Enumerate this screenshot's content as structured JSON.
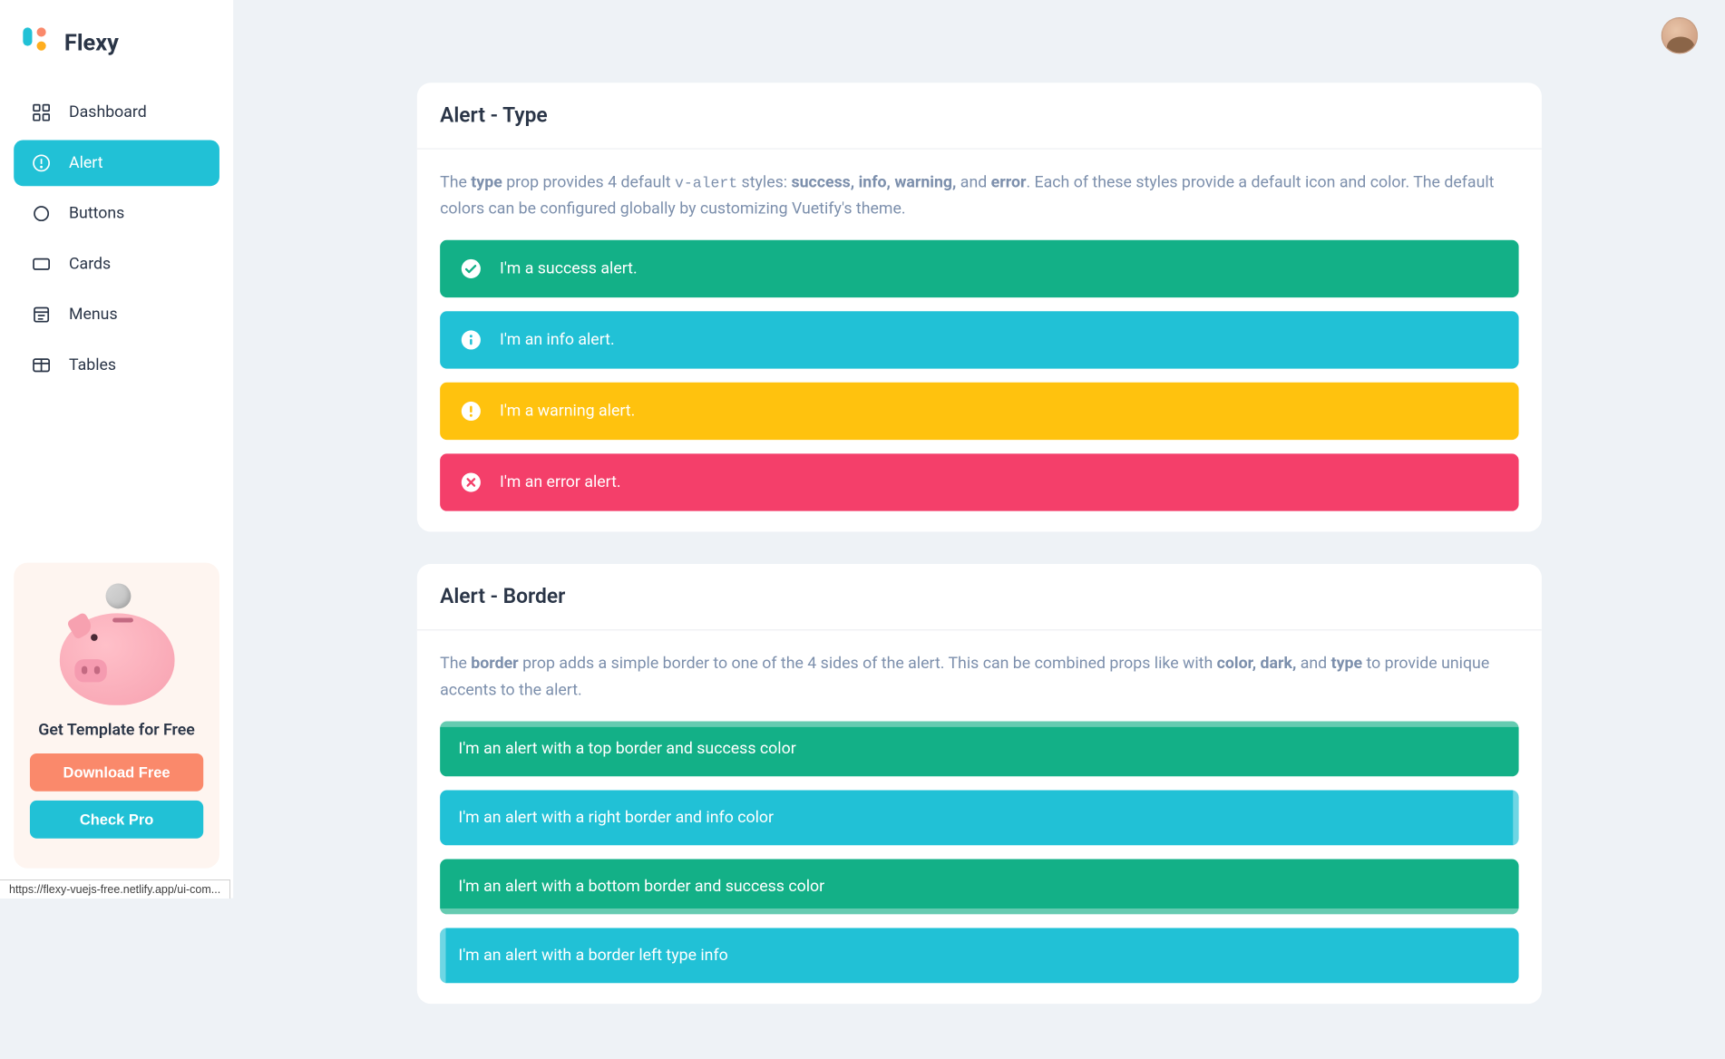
{
  "app": {
    "name": "Flexy"
  },
  "sidebar": {
    "items": [
      {
        "label": "Dashboard",
        "icon": "dashboard"
      },
      {
        "label": "Alert",
        "icon": "alert",
        "active": true
      },
      {
        "label": "Buttons",
        "icon": "circle"
      },
      {
        "label": "Cards",
        "icon": "card"
      },
      {
        "label": "Menus",
        "icon": "menu"
      },
      {
        "label": "Tables",
        "icon": "table"
      }
    ]
  },
  "promo": {
    "title": "Get Template for Free",
    "download_btn": "Download Free",
    "pro_btn": "Check Pro"
  },
  "colors": {
    "success": "#13b087",
    "info": "#21c1d6",
    "warning": "#ffc20e",
    "error": "#f43f6a",
    "orange": "#fa896b"
  },
  "cards": {
    "type": {
      "title": "Alert - Type",
      "desc_pre": "The ",
      "desc_b1": "type",
      "desc_mid1": " prop provides 4 default ",
      "desc_code": "v-alert",
      "desc_mid2": " styles: ",
      "desc_b2": "success, info, warning,",
      "desc_mid3": " and ",
      "desc_b3": "error",
      "desc_post": ". Each of these styles provide a default icon and color. The default colors can be configured globally by customizing Vuetify's theme.",
      "alerts": [
        {
          "text": "I'm a success alert.",
          "kind": "success"
        },
        {
          "text": "I'm an info alert.",
          "kind": "info"
        },
        {
          "text": "I'm a warning alert.",
          "kind": "warning"
        },
        {
          "text": "I'm an error alert.",
          "kind": "error"
        }
      ]
    },
    "border": {
      "title": "Alert - Border",
      "desc_pre": "The ",
      "desc_b1": "border",
      "desc_mid1": " prop adds a simple border to one of the 4 sides of the alert. This can be combined props like with ",
      "desc_b2": "color, dark,",
      "desc_mid2": " and ",
      "desc_b3": "type",
      "desc_post": " to provide unique accents to the alert.",
      "alerts": [
        {
          "text": "I'm an alert with a top border and success color",
          "kind": "success",
          "border": "top"
        },
        {
          "text": "I'm an alert with a right border and info color",
          "kind": "info",
          "border": "right"
        },
        {
          "text": "I'm an alert with a bottom border and success color",
          "kind": "success",
          "border": "bottom"
        },
        {
          "text": "I'm an alert with a border left type info",
          "kind": "info",
          "border": "left"
        }
      ]
    }
  },
  "status_url": "https://flexy-vuejs-free.netlify.app/ui-com..."
}
